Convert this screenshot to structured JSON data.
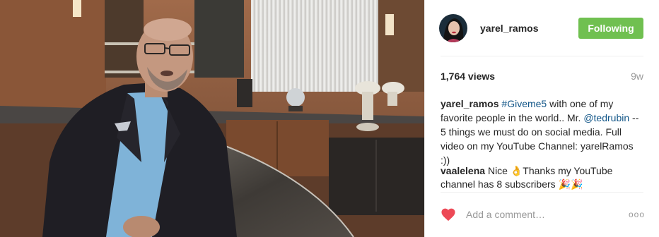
{
  "post": {
    "username": "yarel_ramos",
    "follow_label": "Following",
    "views": "1,764 views",
    "age": "9w"
  },
  "caption": {
    "user": "yarel_ramos",
    "hashtag": "#Giveme5",
    "text_1": " with one of my favorite people in the world.. Mr. ",
    "mention": "@tedrubin",
    "text_2": " -- 5 things we must do on social media. Full video on my YouTube Channel: yarelRamos :))"
  },
  "comment": {
    "user": "vaalelena",
    "text_1": " Nice ",
    "emoji_1": "👌",
    "text_2": "Thanks my YouTube channel has 8 subscribers ",
    "emoji_2": "🎉🎉"
  },
  "footer": {
    "placeholder": "Add a comment…",
    "more": "ooo"
  },
  "colors": {
    "follow_bg": "#70c050",
    "link": "#125688",
    "heart": "#ed4956"
  }
}
